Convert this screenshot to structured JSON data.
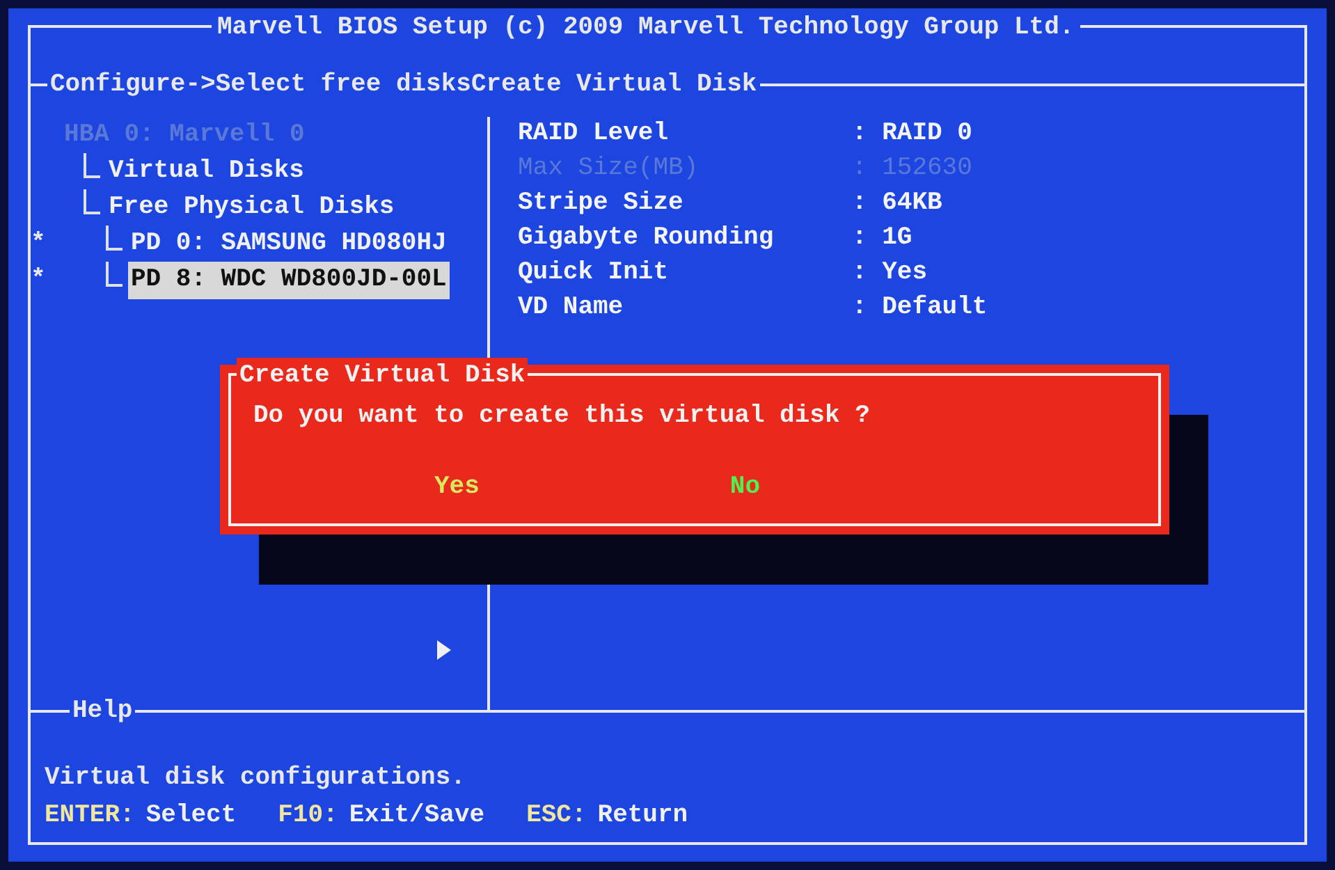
{
  "window": {
    "title": "Marvell BIOS Setup (c) 2009 Marvell Technology Group Ltd."
  },
  "breadcrumb": "Configure->Select free disksCreate Virtual Disk",
  "tree": [
    {
      "label": "HBA 0: Marvell 0",
      "disabled": true,
      "selected": false,
      "children": [
        {
          "label": "Virtual Disks",
          "disabled": false,
          "selected": false
        },
        {
          "label": "Free Physical Disks",
          "disabled": false,
          "selected": false,
          "children": [
            {
              "label": "PD 0: SAMSUNG HD080HJ",
              "mark": "*",
              "disabled": false,
              "selected": false
            },
            {
              "label": "PD 8: WDC WD800JD-00L",
              "mark": "*",
              "disabled": false,
              "selected": true
            }
          ]
        }
      ]
    }
  ],
  "settings": [
    {
      "label": "RAID Level",
      "value": ": RAID 0",
      "disabled": false
    },
    {
      "label": "Max Size(MB)",
      "value": ": 152630",
      "disabled": true
    },
    {
      "label": "Stripe Size",
      "value": ": 64KB",
      "disabled": false
    },
    {
      "label": "Gigabyte Rounding",
      "value": ": 1G",
      "disabled": false
    },
    {
      "label": "Quick Init",
      "value": ": Yes",
      "disabled": false
    },
    {
      "label": "VD Name",
      "value": ": Default",
      "disabled": false
    }
  ],
  "dialog": {
    "title": "Create Virtual Disk",
    "message": "Do you want to create this virtual disk ?",
    "buttons": [
      "Yes",
      "No"
    ]
  },
  "help": {
    "title": "Help",
    "text": "Virtual disk configurations.",
    "keys": [
      {
        "key": "ENTER:",
        "action": "Select"
      },
      {
        "key": "F10:",
        "action": "Exit/Save"
      },
      {
        "key": "ESC:",
        "action": "Return"
      }
    ]
  }
}
